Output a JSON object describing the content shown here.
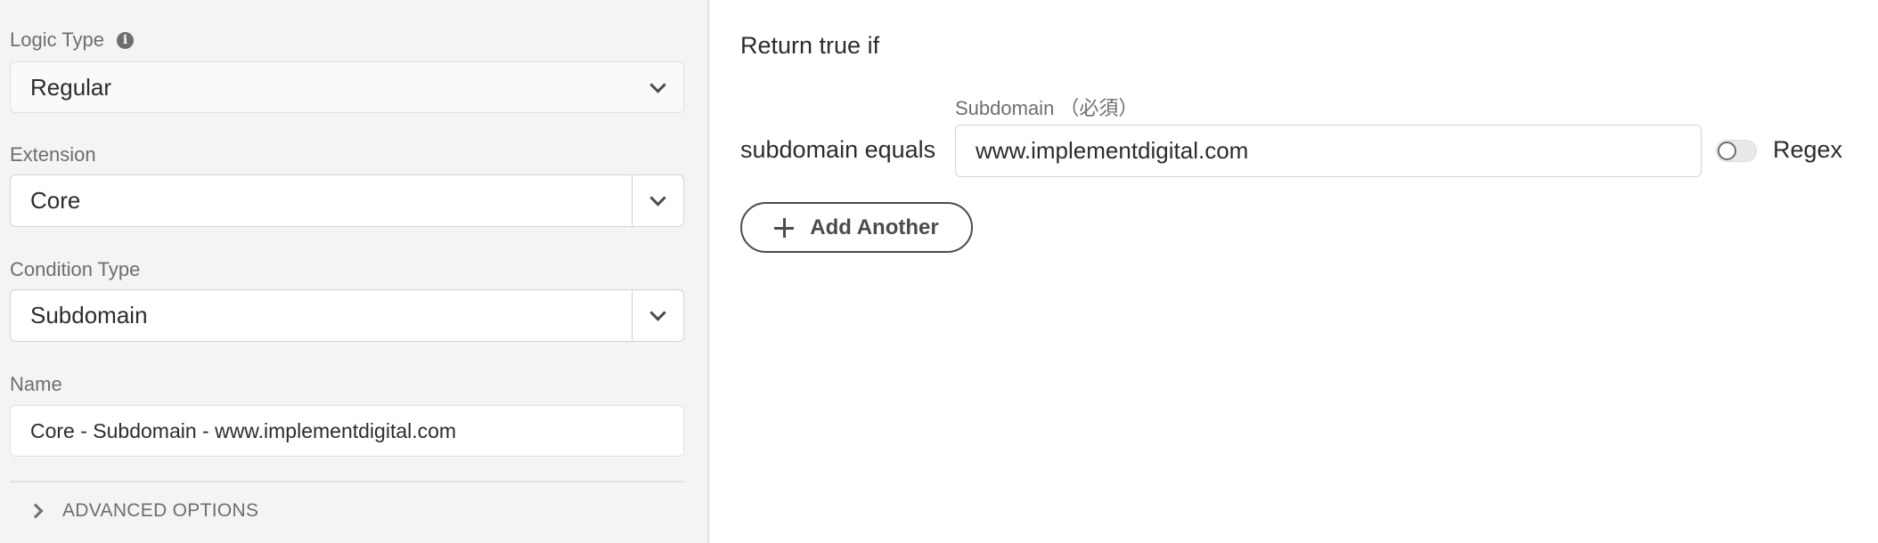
{
  "sidebar": {
    "logic_type": {
      "label": "Logic Type",
      "value": "Regular"
    },
    "extension": {
      "label": "Extension",
      "value": "Core"
    },
    "condition_type": {
      "label": "Condition Type",
      "value": "Subdomain"
    },
    "name": {
      "label": "Name",
      "value": "Core - Subdomain - www.implementdigital.com"
    },
    "advanced_options": "ADVANCED OPTIONS"
  },
  "main": {
    "heading": "Return true if",
    "condition_label": "subdomain equals",
    "subdomain_field_label": "Subdomain （必須）",
    "subdomain_value": "www.implementdigital.com",
    "regex_label": "Regex",
    "regex_enabled": false,
    "add_button_label": "Add Another"
  },
  "icons": {
    "info": "info-icon",
    "chevron": "chevron-down-icon",
    "expand": "chevron-right-icon",
    "add": "plus-icon"
  }
}
